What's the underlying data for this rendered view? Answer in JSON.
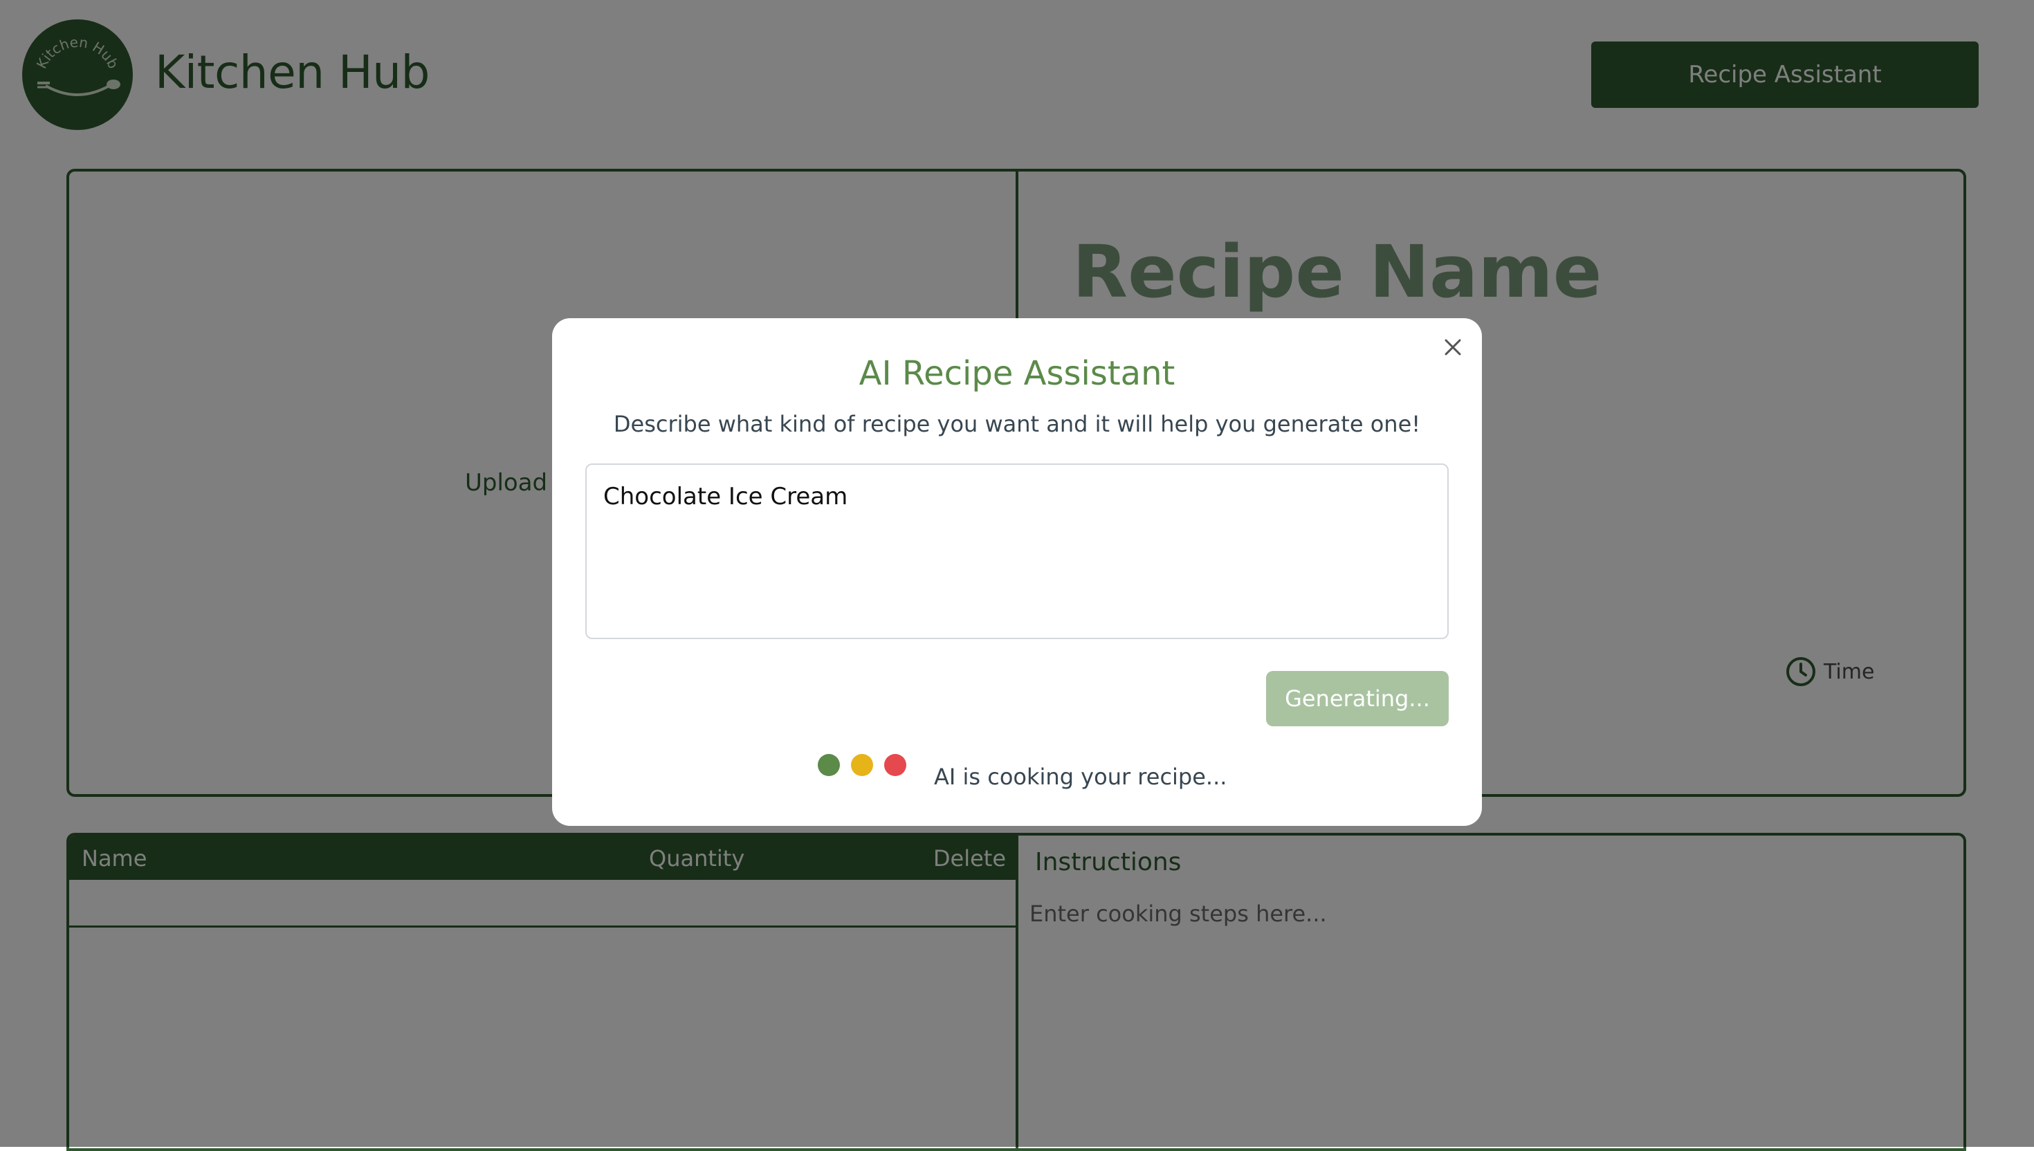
{
  "header": {
    "logo_text": "Kitchen Hub",
    "brand": "Kitchen Hub",
    "assistant_button": "Recipe Assistant"
  },
  "recipe": {
    "name_placeholder": "Recipe Name",
    "upload_label": "Upload I",
    "time_label": "Time"
  },
  "ingredients": {
    "columns": [
      "Name",
      "Quantity",
      "Delete"
    ]
  },
  "instructions": {
    "title": "Instructions",
    "placeholder": "Enter cooking steps here..."
  },
  "modal": {
    "title": "AI Recipe Assistant",
    "description": "Describe what kind of recipe you want and it will help you generate one!",
    "prompt_value": "Chocolate Ice Cream",
    "generate_button": "Generating...",
    "status": "AI is cooking your recipe...",
    "dot_colors": [
      "#5b8a49",
      "#e6b319",
      "#e5484d"
    ]
  },
  "colors": {
    "brand_green": "#2f5a2f",
    "title_green": "#5b8a49",
    "disabled_button": "#a9c3a1"
  }
}
